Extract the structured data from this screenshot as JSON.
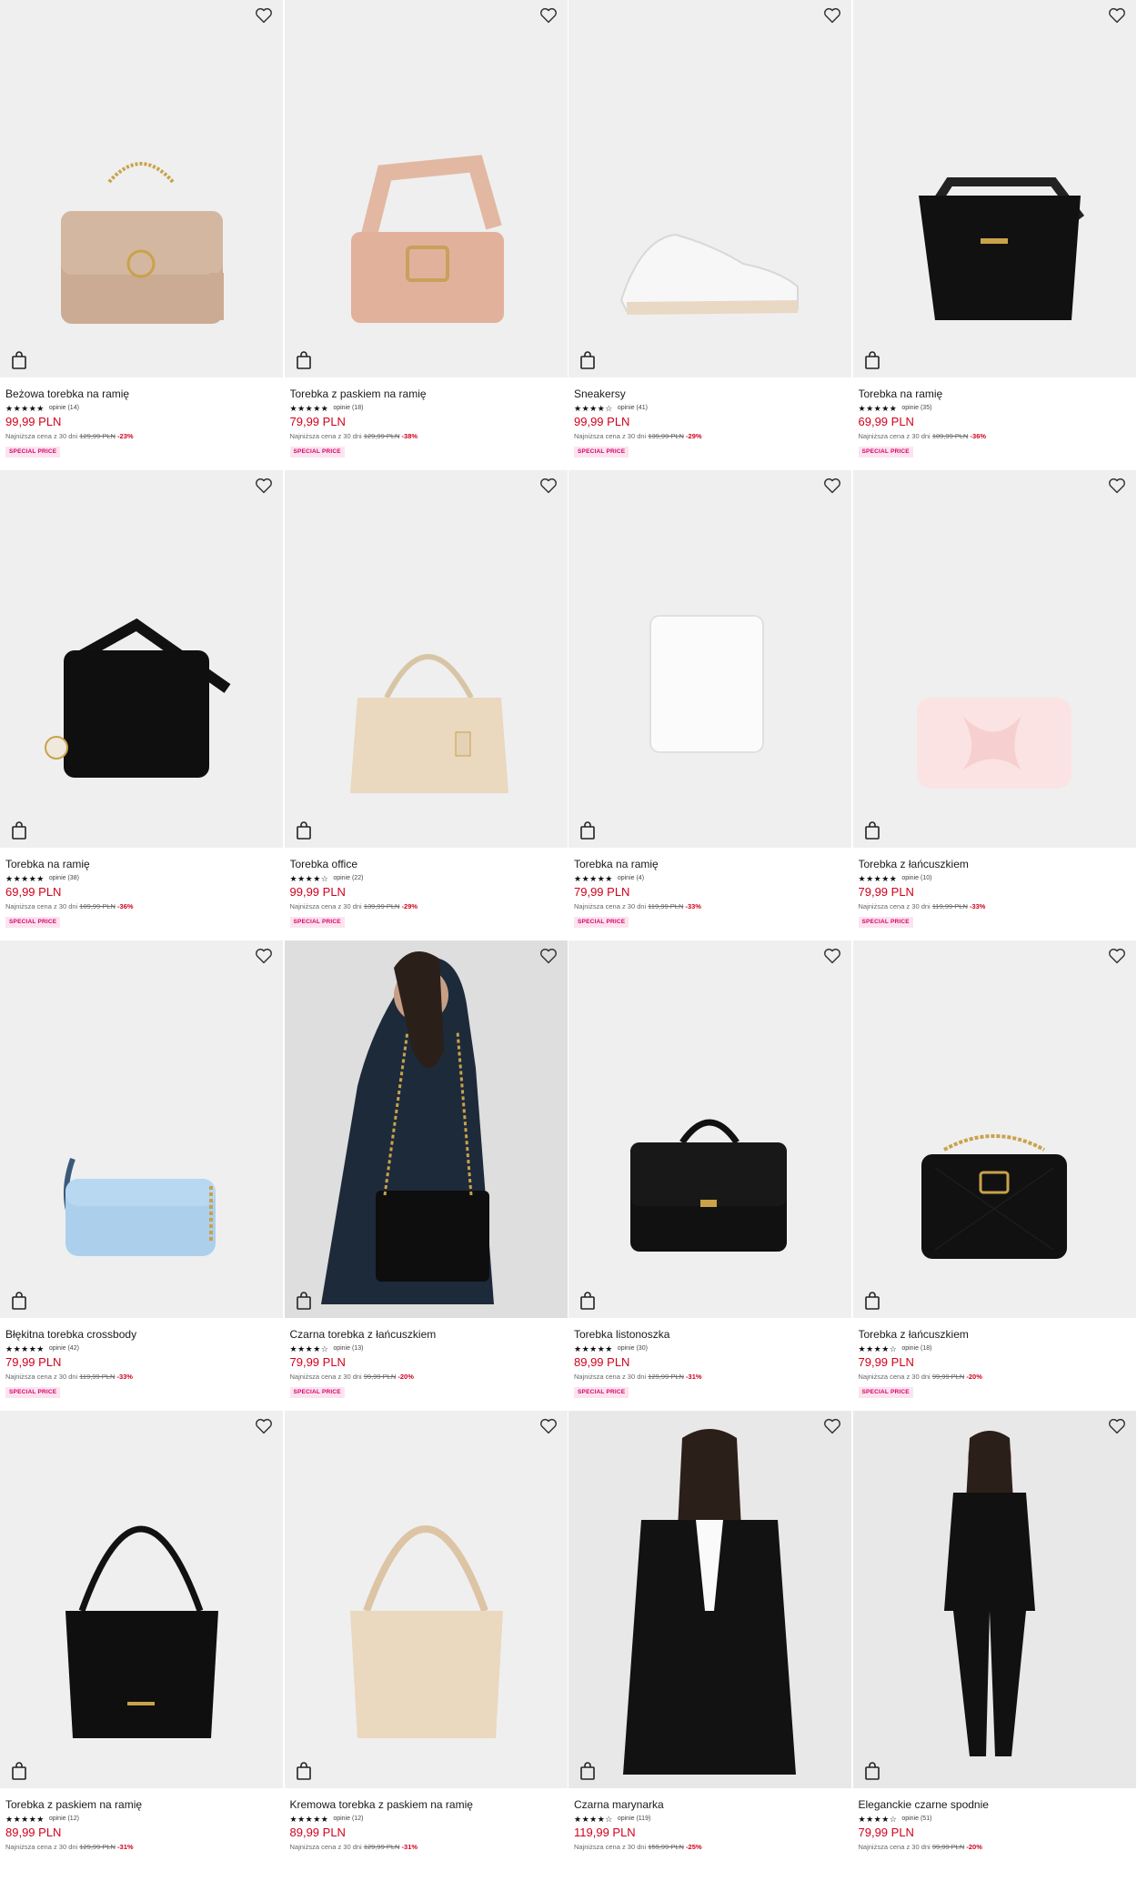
{
  "products": [
    {
      "name": "Beżowa torebka na ramię",
      "stars": "★★★★★",
      "reviews": "opinie (14)",
      "price": "99,99 PLN",
      "lowest_prefix": "Najniższa cena z 30 dni",
      "lowest_old": "129,99 PLN",
      "discount": "-23%",
      "badge": "SPECIAL PRICE",
      "icon": "beige-shoulder-bag-chain"
    },
    {
      "name": "Torebka z paskiem na ramię",
      "stars": "★★★★★",
      "reviews": "opinie (18)",
      "price": "79,99 PLN",
      "lowest_prefix": "Najniższa cena z 30 dni",
      "lowest_old": "129,99 PLN",
      "discount": "-38%",
      "badge": "SPECIAL PRICE",
      "icon": "pink-strap-bag"
    },
    {
      "name": "Sneakersy",
      "stars": "★★★★☆",
      "reviews": "opinie (41)",
      "price": "99,99 PLN",
      "lowest_prefix": "Najniższa cena z 30 dni",
      "lowest_old": "139,99 PLN",
      "discount": "-29%",
      "badge": "SPECIAL PRICE",
      "icon": "white-sneaker"
    },
    {
      "name": "Torebka na ramię",
      "stars": "★★★★★",
      "reviews": "opinie (35)",
      "price": "69,99 PLN",
      "lowest_prefix": "Najniższa cena z 30 dni",
      "lowest_old": "109,99 PLN",
      "discount": "-36%",
      "badge": "SPECIAL PRICE",
      "icon": "black-bucket-bag"
    },
    {
      "name": "Torebka na ramię",
      "stars": "★★★★★",
      "reviews": "opinie (38)",
      "price": "69,99 PLN",
      "lowest_prefix": "Najniższa cena z 30 dni",
      "lowest_old": "109,99 PLN",
      "discount": "-36%",
      "badge": "SPECIAL PRICE",
      "icon": "black-messenger-bag"
    },
    {
      "name": "Torebka office",
      "stars": "★★★★☆",
      "reviews": "opinie (22)",
      "price": "99,99 PLN",
      "lowest_prefix": "Najniższa cena z 30 dni",
      "lowest_old": "139,99 PLN",
      "discount": "-29%",
      "badge": "SPECIAL PRICE",
      "icon": "beige-office-tote"
    },
    {
      "name": "Torebka na ramię",
      "stars": "★★★★★",
      "reviews": "opinie (4)",
      "price": "79,99 PLN",
      "lowest_prefix": "Najniższa cena z 30 dni",
      "lowest_old": "119,99 PLN",
      "discount": "-33%",
      "badge": "SPECIAL PRICE",
      "icon": "white-shoulder-bag"
    },
    {
      "name": "Torebka z łańcuszkiem",
      "stars": "★★★★★",
      "reviews": "opinie (10)",
      "price": "79,99 PLN",
      "lowest_prefix": "Najniższa cena z 30 dni",
      "lowest_old": "119,99 PLN",
      "discount": "-33%",
      "badge": "SPECIAL PRICE",
      "icon": "pink-bow-clutch"
    },
    {
      "name": "Błękitna torebka crossbody",
      "stars": "★★★★★",
      "reviews": "opinie (42)",
      "price": "79,99 PLN",
      "lowest_prefix": "Najniższa cena z 30 dni",
      "lowest_old": "119,99 PLN",
      "discount": "-33%",
      "badge": "SPECIAL PRICE",
      "icon": "blue-crossbody-bag"
    },
    {
      "name": "Czarna torebka z łańcuszkiem",
      "stars": "★★★★☆",
      "reviews": "opinie (13)",
      "price": "79,99 PLN",
      "lowest_prefix": "Najniższa cena z 30 dni",
      "lowest_old": "99,99 PLN",
      "discount": "-20%",
      "badge": "SPECIAL PRICE",
      "icon": "model-black-chain-bag"
    },
    {
      "name": "Torebka listonoszka",
      "stars": "★★★★★",
      "reviews": "opinie (30)",
      "price": "89,99 PLN",
      "lowest_prefix": "Najniższa cena z 30 dni",
      "lowest_old": "129,99 PLN",
      "discount": "-31%",
      "badge": "SPECIAL PRICE",
      "icon": "black-flap-bag"
    },
    {
      "name": "Torebka z łańcuszkiem",
      "stars": "★★★★☆",
      "reviews": "opinie (18)",
      "price": "79,99 PLN",
      "lowest_prefix": "Najniższa cena z 30 dni",
      "lowest_old": "99,99 PLN",
      "discount": "-20%",
      "badge": "SPECIAL PRICE",
      "icon": "black-quilted-bag"
    },
    {
      "name": "Torebka z paskiem na ramię",
      "stars": "★★★★★",
      "reviews": "opinie (12)",
      "price": "89,99 PLN",
      "lowest_prefix": "Najniższa cena z 30 dni",
      "lowest_old": "129,99 PLN",
      "discount": "-31%",
      "badge": "",
      "icon": "black-hobo-bag"
    },
    {
      "name": "Kremowa torebka z paskiem na ramię",
      "stars": "★★★★★",
      "reviews": "opinie (12)",
      "price": "89,99 PLN",
      "lowest_prefix": "Najniższa cena z 30 dni",
      "lowest_old": "129,99 PLN",
      "discount": "-31%",
      "badge": "",
      "icon": "cream-hobo-bag"
    },
    {
      "name": "Czarna marynarka",
      "stars": "★★★★☆",
      "reviews": "opinie (119)",
      "price": "119,99 PLN",
      "lowest_prefix": "Najniższa cena z 30 dni",
      "lowest_old": "159,99 PLN",
      "discount": "-25%",
      "badge": "",
      "icon": "model-black-blazer"
    },
    {
      "name": "Eleganckie czarne spodnie",
      "stars": "★★★★☆",
      "reviews": "opinie (51)",
      "price": "79,99 PLN",
      "lowest_prefix": "Najniższa cena z 30 dni",
      "lowest_old": "99,99 PLN",
      "discount": "-20%",
      "badge": "",
      "icon": "model-black-trousers"
    }
  ],
  "colors": {
    "price": "#d1021d",
    "badge_bg": "#fce4ef",
    "badge_text": "#d9006c",
    "image_bg": "#efefef"
  }
}
